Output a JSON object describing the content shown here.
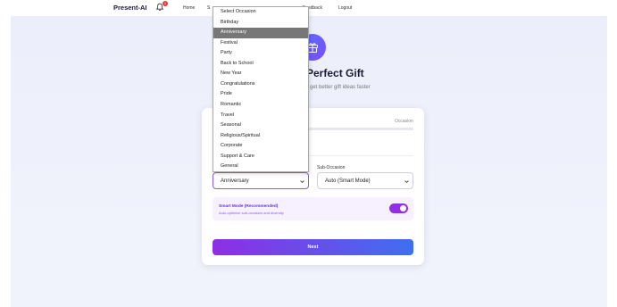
{
  "nav": {
    "brand": "Present-AI",
    "notification_count": "1",
    "links": [
      "Home",
      "S",
      "Feedback",
      "Logout"
    ]
  },
  "hero": {
    "title": "Perfect Gift",
    "subtitle": "get better gift ideas faster"
  },
  "form": {
    "step_label": "Occasion",
    "occasion_value": "Anniversary",
    "sub_occasion_label": "Sub-Occasion",
    "sub_occasion_value": "Auto (Smart Mode)",
    "smart_mode_title": "Smart Mode (Recommended)",
    "smart_mode_desc": "Auto-optimize sub-occasion and diversity",
    "smart_mode_on": true,
    "next_label": "Next"
  },
  "dropdown": {
    "options": [
      "Select Occasion",
      "Birthday",
      "Anniversary",
      "Festival",
      "Party",
      "Back to School",
      "New Year",
      "Congratulations",
      "Pride",
      "Romantic",
      "Travel",
      "Seasonal",
      "Religious/Spiritual",
      "Corporate",
      "Support & Care",
      "General"
    ],
    "selected_index": 2
  },
  "colors": {
    "accent": "#8f2fe6",
    "button_gradient_start": "#8e2ee6",
    "button_gradient_end": "#3f6ff0",
    "badge": "#e53935"
  },
  "icons": [
    "bell-icon",
    "gift-icon",
    "chevron-down-icon"
  ]
}
